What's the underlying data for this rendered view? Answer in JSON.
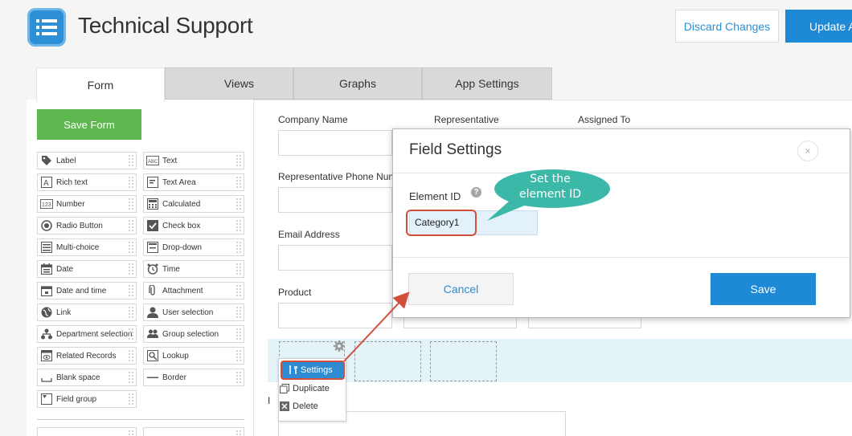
{
  "header": {
    "title": "Technical Support",
    "discard_label": "Discard Changes",
    "update_label": "Update A"
  },
  "tabs": [
    {
      "label": "Form",
      "active": true
    },
    {
      "label": "Views",
      "active": false
    },
    {
      "label": "Graphs",
      "active": false
    },
    {
      "label": "App Settings",
      "active": false
    }
  ],
  "palette": {
    "save_form_label": "Save Form",
    "items": [
      {
        "label": "Label",
        "icon": "tag-icon"
      },
      {
        "label": "Text",
        "icon": "abc-icon"
      },
      {
        "label": "Rich text",
        "icon": "rich-text-icon"
      },
      {
        "label": "Text Area",
        "icon": "text-area-icon"
      },
      {
        "label": "Number",
        "icon": "number-icon"
      },
      {
        "label": "Calculated",
        "icon": "calculator-icon"
      },
      {
        "label": "Radio Button",
        "icon": "radio-icon"
      },
      {
        "label": "Check box",
        "icon": "checkbox-icon"
      },
      {
        "label": "Multi-choice",
        "icon": "multi-choice-icon"
      },
      {
        "label": "Drop-down",
        "icon": "dropdown-icon"
      },
      {
        "label": "Date",
        "icon": "calendar-icon"
      },
      {
        "label": "Time",
        "icon": "clock-icon"
      },
      {
        "label": "Date and time",
        "icon": "calendar-time-icon"
      },
      {
        "label": "Attachment",
        "icon": "paperclip-icon"
      },
      {
        "label": "Link",
        "icon": "globe-icon"
      },
      {
        "label": "User selection",
        "icon": "user-icon"
      },
      {
        "label": "Department selection",
        "icon": "org-chart-icon"
      },
      {
        "label": "Group selection",
        "icon": "group-icon"
      },
      {
        "label": "Related Records",
        "icon": "related-records-icon"
      },
      {
        "label": "Lookup",
        "icon": "lookup-icon"
      },
      {
        "label": "Blank space",
        "icon": "blank-space-icon"
      },
      {
        "label": "Border",
        "icon": "border-line-icon"
      },
      {
        "label": "Field group",
        "icon": "field-group-icon"
      }
    ]
  },
  "form": {
    "company_name": "Company Name",
    "representative": "Representative",
    "assigned_to": "Assigned To",
    "rep_phone": "Representative Phone Numb",
    "email": "Email Address",
    "product": "Product",
    "partial_label": "I"
  },
  "context_menu": {
    "settings": "Settings",
    "duplicate": "Duplicate",
    "delete": "Delete"
  },
  "dialog": {
    "title": "Field Settings",
    "close": "×",
    "element_id_label": "Element ID",
    "help": "?",
    "element_id_value": "Category1",
    "cancel": "Cancel",
    "save": "Save"
  },
  "callout": {
    "line1": "Set the",
    "line2": "element ID",
    "color": "#3cb8a9"
  },
  "colors": {
    "accent": "#1e8ad6",
    "save_form": "#5fb84f",
    "highlight": "#d14f3b"
  }
}
